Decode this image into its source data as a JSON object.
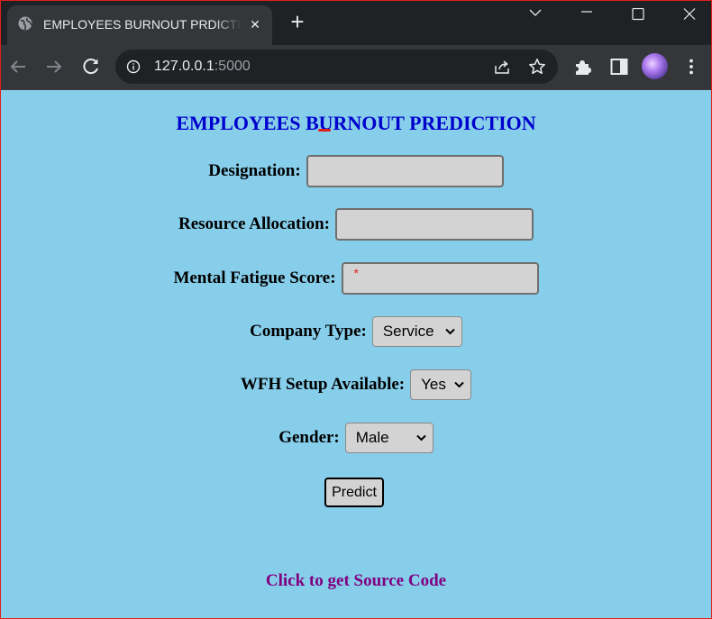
{
  "browser": {
    "tab_title": "EMPLOYEES BURNOUT PRDICTION",
    "new_tab_symbol": "+",
    "close_symbol": "✕",
    "url_host": "127.0.0.1",
    "url_port": ":5000"
  },
  "page": {
    "title": "EMPLOYEES BURNOUT PREDICTION",
    "fields": {
      "designation": {
        "label": "Designation:",
        "value": ""
      },
      "resource_allocation": {
        "label": "Resource Allocation:",
        "value": ""
      },
      "mental_fatigue": {
        "label": "Mental Fatigue Score:",
        "value": "",
        "required_marker": "*"
      },
      "company_type": {
        "label": "Company Type:",
        "selected": "Service"
      },
      "wfh": {
        "label": "WFH Setup Available:",
        "selected": "Yes"
      },
      "gender": {
        "label": "Gender:",
        "selected": "Male"
      }
    },
    "predict_label": "Predict",
    "source_link": "Click to get Source Code"
  },
  "colors": {
    "page_background": "#87ceeb",
    "title": "#0000cd",
    "link": "#800080",
    "input_background": "#d3d3d3"
  },
  "icons": [
    "globe-favicon-icon",
    "close-icon",
    "plus-icon",
    "chevron-down-icon",
    "minimize-icon",
    "maximize-icon",
    "window-close-icon",
    "back-arrow-icon",
    "forward-arrow-icon",
    "reload-icon",
    "info-icon",
    "share-icon",
    "star-icon",
    "extensions-icon",
    "side-panel-icon",
    "kebab-menu-icon"
  ]
}
